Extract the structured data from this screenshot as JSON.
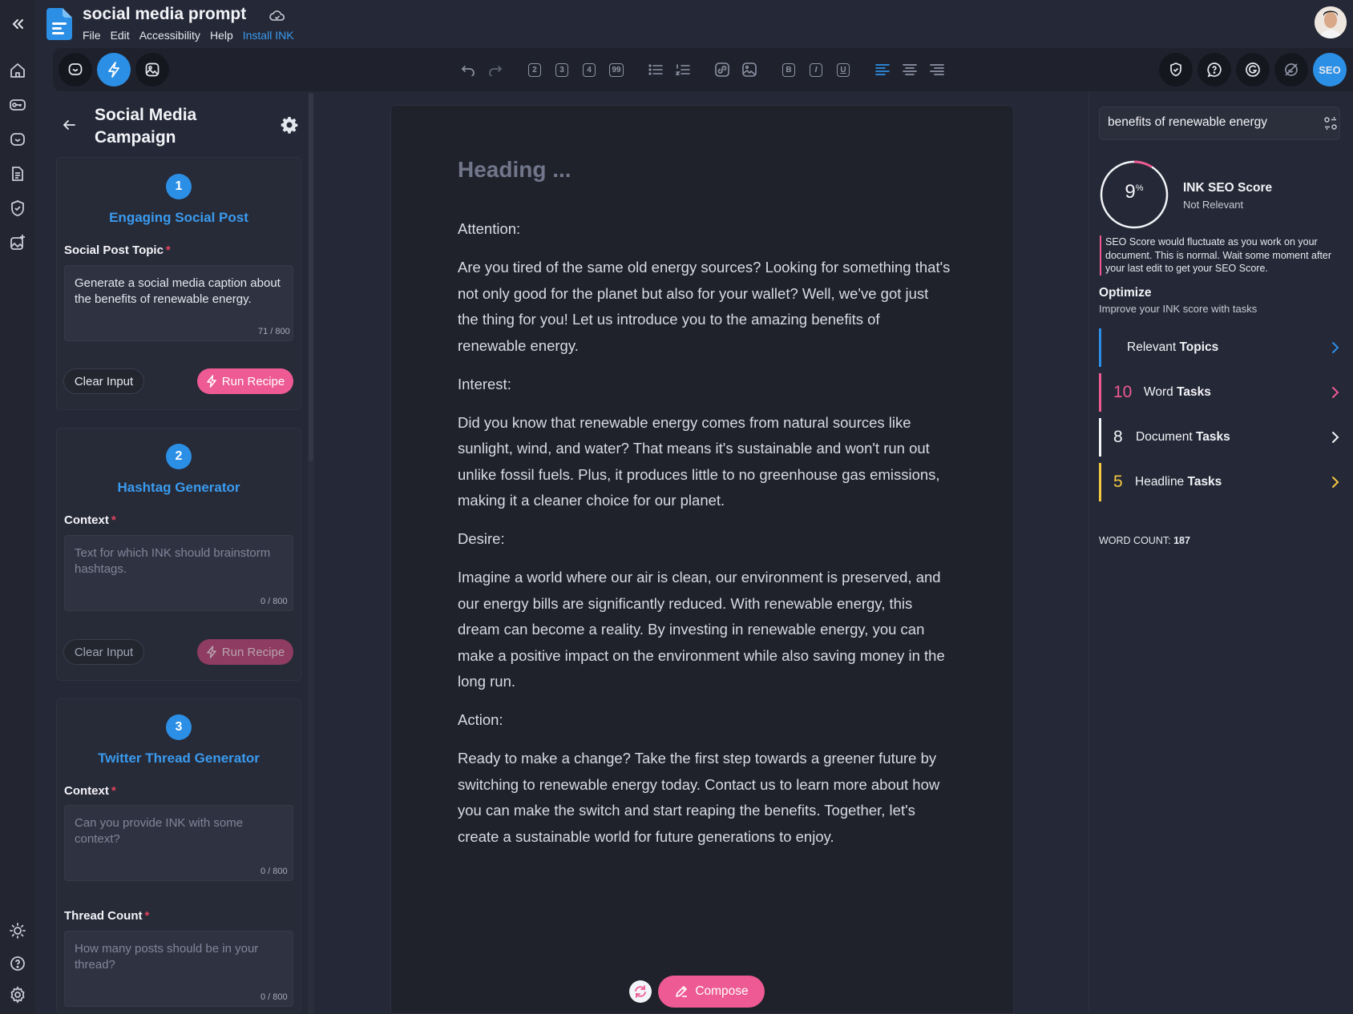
{
  "header": {
    "doc_title": "social media prompt",
    "menus": [
      "File",
      "Edit",
      "Accessibility",
      "Help",
      "Install INK"
    ],
    "seo_label": "SEO"
  },
  "toolbar": {
    "h2": "2",
    "h3": "3",
    "h4": "4",
    "quote": "99",
    "bold": "B",
    "italic": "I",
    "underline": "U"
  },
  "left_panel": {
    "title": "Social Media Campaign",
    "cards": [
      {
        "step": "1",
        "title": "Engaging Social Post",
        "fields": [
          {
            "label": "Social Post Topic",
            "value": "Generate a social media caption about the benefits of renewable energy.",
            "placeholder": "",
            "counter": "71 / 800"
          }
        ],
        "clear_label": "Clear Input",
        "run_label": "Run Recipe"
      },
      {
        "step": "2",
        "title": "Hashtag Generator",
        "fields": [
          {
            "label": "Context",
            "value": "",
            "placeholder": "Text for which INK should brainstorm hashtags.",
            "counter": "0 / 800"
          }
        ],
        "clear_label": "Clear Input",
        "run_label": "Run Recipe"
      },
      {
        "step": "3",
        "title": "Twitter Thread Generator",
        "fields": [
          {
            "label": "Context",
            "value": "",
            "placeholder": "Can you provide INK with some context?",
            "counter": "0 / 800"
          },
          {
            "label": "Thread Count",
            "value": "",
            "placeholder": "How many posts should be in your thread?",
            "counter": "0 / 800"
          }
        ]
      }
    ]
  },
  "editor": {
    "heading_placeholder": "Heading ...",
    "paragraphs": [
      "Attention:",
      "Are you tired of the same old energy sources? Looking for something that's not only good for the planet but also for your wallet? Well, we've got just the thing for you! Let us introduce you to the amazing benefits of renewable energy.",
      "Interest:",
      "Did you know that renewable energy comes from natural sources like sunlight, wind, and water? That means it's sustainable and won't run out unlike fossil fuels. Plus, it produces little to no greenhouse gas emissions, making it a cleaner choice for our planet.",
      "Desire:",
      "Imagine a world where our air is clean, our environment is preserved, and our energy bills are significantly reduced. With renewable energy, this dream can become a reality. By investing in renewable energy, you can make a positive impact on the environment while also saving money in the long run.",
      "Action:",
      "Ready to make a change? Take the first step towards a greener future by switching to renewable energy today. Contact us to learn more about how you can make the switch and start reaping the benefits. Together, let's create a sustainable world for future generations to enjoy."
    ],
    "compose_label": "Compose"
  },
  "seo": {
    "keyword": "benefits of renewable energy",
    "score_value": "9",
    "score_unit": "%",
    "score_fraction": 0.09,
    "score_title": "INK SEO Score",
    "score_status": "Not Relevant",
    "note": "SEO Score would fluctuate as you work on your document. This is normal. Wait some moment after your last edit to get your SEO Score.",
    "optimize_title": "Optimize",
    "optimize_sub": "Improve your INK score with tasks",
    "tasks": [
      {
        "num": "",
        "pre": "Relevant ",
        "bold": "Topics",
        "color": "#2b8fe6"
      },
      {
        "num": "10",
        "pre": "Word ",
        "bold": "Tasks",
        "color": "#ee5a93"
      },
      {
        "num": "8",
        "pre": "Document ",
        "bold": "Tasks",
        "color": "#f3f4f8"
      },
      {
        "num": "5",
        "pre": "Headline ",
        "bold": "Tasks",
        "color": "#f5c842"
      }
    ],
    "word_count_label": "WORD COUNT:",
    "word_count_value": "187"
  },
  "colors": {
    "accent_blue": "#2b8fe6",
    "accent_pink": "#ee5a93",
    "background": "#252836"
  }
}
